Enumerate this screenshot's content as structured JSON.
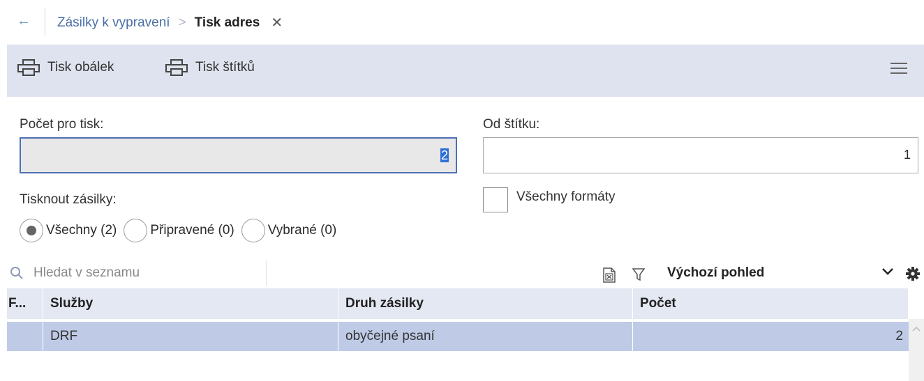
{
  "breadcrumb": {
    "back_glyph": "←",
    "parent": "Zásilky k vypravení",
    "separator": ">",
    "current": "Tisk adres",
    "close_glyph": "✕"
  },
  "toolbar": {
    "print_envelopes": "Tisk obálek",
    "print_labels": "Tisk štítků",
    "icon_print": "printer-icon",
    "icon_menu": "hamburger-menu-icon"
  },
  "form": {
    "count_label": "Počet pro tisk:",
    "count_value": "2",
    "from_label": "Od štítku:",
    "from_value": "1",
    "all_formats_label": "Všechny formáty",
    "print_items_label": "Tisknout zásilky:",
    "radios": [
      {
        "label": "Všechny (2)",
        "checked": true
      },
      {
        "label": "Připravené (0)",
        "checked": false
      },
      {
        "label": "Vybrané (0)",
        "checked": false
      }
    ]
  },
  "list": {
    "search_placeholder": "Hledat v seznamu",
    "view": "Výchozí pohled",
    "columns": [
      "F...",
      "Služby",
      "Druh zásilky",
      "Počet"
    ],
    "rows": [
      {
        "f": "",
        "sluzby": "DRF",
        "druh": "obyčejné psaní",
        "pocet": "2"
      }
    ]
  },
  "colors": {
    "accent": "#4e6fb5",
    "toolbar_bg": "#dfe3ef",
    "selected_row": "#bfcbe6",
    "header_bg": "#e4e8f2"
  }
}
